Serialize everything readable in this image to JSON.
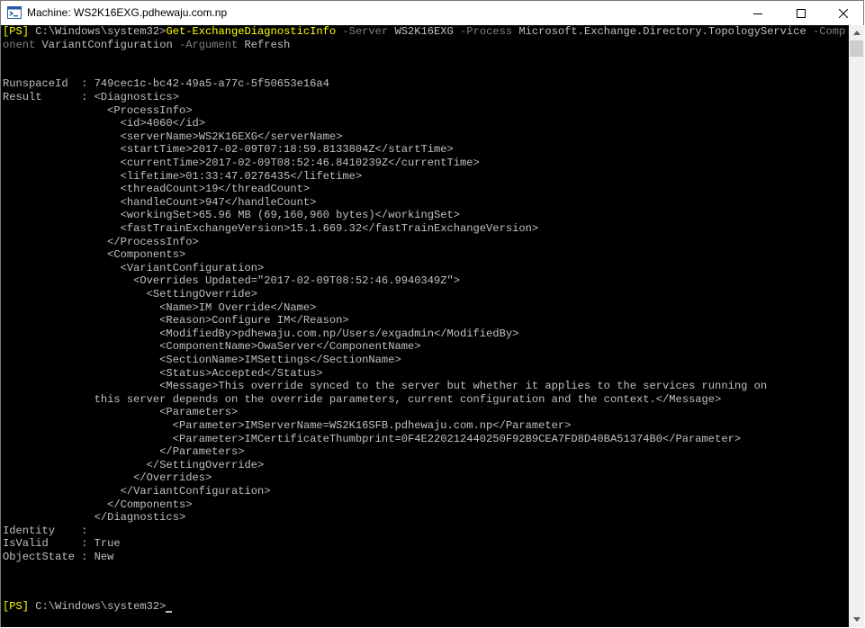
{
  "window": {
    "title": "Machine: WS2K16EXG.pdhewaju.com.np"
  },
  "command": {
    "prompt": "[PS]",
    "path": " C:\\Windows\\system32>",
    "cmdlet": "Get-ExchangeDiagnosticInfo",
    "p_server": " -Server ",
    "v_server": "WS2K16EXG",
    "p_process": " -Process ",
    "v_process": "Microsoft.Exchange.Directory.TopologyService",
    "p_comp_a": " -Comp",
    "p_comp_b": "onent",
    "v_comp": " VariantConfiguration",
    "p_arg": " -Argument",
    "v_arg": " Refresh"
  },
  "output": [
    "RunspaceId  : 749cec1c-bc42-49a5-a77c-5f50653e16a4",
    "Result      : <Diagnostics>",
    "                <ProcessInfo>",
    "                  <id>4060</id>",
    "                  <serverName>WS2K16EXG</serverName>",
    "                  <startTime>2017-02-09T07:18:59.8133804Z</startTime>",
    "                  <currentTime>2017-02-09T08:52:46.8410239Z</currentTime>",
    "                  <lifetime>01:33:47.0276435</lifetime>",
    "                  <threadCount>19</threadCount>",
    "                  <handleCount>947</handleCount>",
    "                  <workingSet>65.96 MB (69,160,960 bytes)</workingSet>",
    "                  <fastTrainExchangeVersion>15.1.669.32</fastTrainExchangeVersion>",
    "                </ProcessInfo>",
    "                <Components>",
    "                  <VariantConfiguration>",
    "                    <Overrides Updated=\"2017-02-09T08:52:46.9940349Z\">",
    "                      <SettingOverride>",
    "                        <Name>IM Override</Name>",
    "                        <Reason>Configure IM</Reason>",
    "                        <ModifiedBy>pdhewaju.com.np/Users/exgadmin</ModifiedBy>",
    "                        <ComponentName>OwaServer</ComponentName>",
    "                        <SectionName>IMSettings</SectionName>",
    "                        <Status>Accepted</Status>",
    "                        <Message>This override synced to the server but whether it applies to the services running on",
    "              this server depends on the override parameters, current configuration and the context.</Message>",
    "                        <Parameters>",
    "                          <Parameter>IMServerName=WS2K16SFB.pdhewaju.com.np</Parameter>",
    "                          <Parameter>IMCertificateThumbprint=0F4E220212440250F92B9CEA7FD8D40BA51374B0</Parameter>",
    "                        </Parameters>",
    "                      </SettingOverride>",
    "                    </Overrides>",
    "                  </VariantConfiguration>",
    "                </Components>",
    "              </Diagnostics>",
    "Identity    :",
    "IsValid     : True",
    "ObjectState : New"
  ],
  "final_prompt": {
    "prompt": "[PS]",
    "path": " C:\\Windows\\system32>"
  },
  "icons": {
    "app": "powershell-remote-icon",
    "minimize": "minimize-icon",
    "maximize": "maximize-icon",
    "close": "close-icon"
  },
  "colors": {
    "console_bg": "#000000",
    "console_fg": "#c0c0c0",
    "prompt": "#ffff00",
    "parameter": "#808080"
  }
}
